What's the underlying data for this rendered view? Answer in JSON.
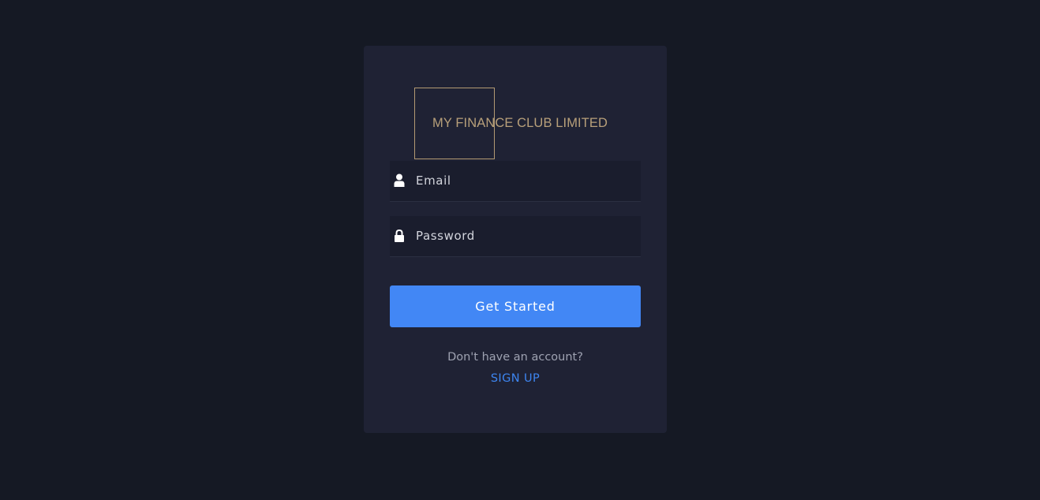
{
  "brand": {
    "name": "MY FINANCE CLUB LIMITED",
    "color": "#b8a07a"
  },
  "form": {
    "email": {
      "placeholder": "Email",
      "value": "",
      "icon": "user-icon"
    },
    "password": {
      "placeholder": "Password",
      "value": "",
      "icon": "lock-icon"
    },
    "submit_label": "Get Started"
  },
  "signup": {
    "prompt": "Don't have an account?",
    "link_label": "SIGN UP"
  },
  "colors": {
    "background": "#151924",
    "card": "#1f2234",
    "accent": "#4287f5",
    "link": "#3d85f0"
  }
}
